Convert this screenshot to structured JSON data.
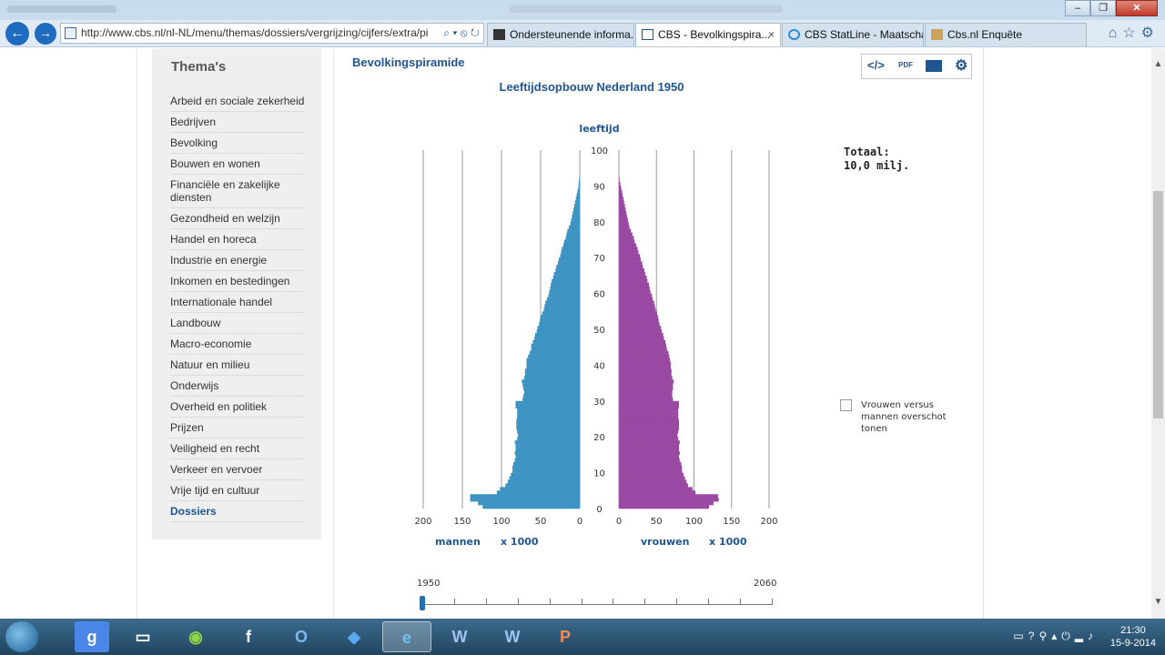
{
  "browser": {
    "address": "http://www.cbs.nl/nl-NL/menu/themas/dossiers/vergrijzing/cijfers/extra/pi",
    "tabs": [
      {
        "label": "Ondersteunende informa..."
      },
      {
        "label": "CBS - Bevolkingspira..."
      },
      {
        "label": "CBS StatLine - Maatscha..."
      },
      {
        "label": "Cbs.nl Enquête"
      }
    ],
    "tab_close": "×"
  },
  "sidebar": {
    "title": "Thema's",
    "items": [
      "Arbeid en sociale zekerheid",
      "Bedrijven",
      "Bevolking",
      "Bouwen en wonen",
      "Financiële en zakelijke diensten",
      "Gezondheid en welzijn",
      "Handel en horeca",
      "Industrie en energie",
      "Inkomen en bestedingen",
      "Internationale handel",
      "Landbouw",
      "Macro-economie",
      "Natuur en milieu",
      "Onderwijs",
      "Overheid en politiek",
      "Prijzen",
      "Veiligheid en recht",
      "Verkeer en vervoer",
      "Vrije tijd en cultuur",
      "Dossiers"
    ]
  },
  "toolbar": {
    "embed_label": "</>",
    "pdf_label": "PDF",
    "image_icon": "image-icon",
    "settings_icon": "gear-icon"
  },
  "chart_data": {
    "type": "bar",
    "title": "Bevolkingspiramide",
    "subtitle": "Leeftijdsopbouw Nederland 1950",
    "ylabel": "leeftijd",
    "x_unit_left": "mannen",
    "x_unit_right": "vrouwen",
    "x_scale_label": "x 1000",
    "xlim": [
      0,
      200
    ],
    "ylim": [
      0,
      100
    ],
    "x_ticks": [
      200,
      150,
      100,
      50,
      0
    ],
    "y_ticks": [
      0,
      10,
      20,
      30,
      40,
      50,
      60,
      70,
      80,
      90,
      100
    ],
    "ages": [
      0,
      1,
      2,
      3,
      4,
      5,
      6,
      7,
      8,
      9,
      10,
      11,
      12,
      13,
      14,
      15,
      16,
      17,
      18,
      19,
      20,
      21,
      22,
      23,
      24,
      25,
      26,
      27,
      28,
      29,
      30,
      31,
      32,
      33,
      34,
      35,
      36,
      37,
      38,
      39,
      40,
      41,
      42,
      43,
      44,
      45,
      46,
      47,
      48,
      49,
      50,
      51,
      52,
      53,
      54,
      55,
      56,
      57,
      58,
      59,
      60,
      61,
      62,
      63,
      64,
      65,
      66,
      67,
      68,
      69,
      70,
      71,
      72,
      73,
      74,
      75,
      76,
      77,
      78,
      79,
      80,
      81,
      82,
      83,
      84,
      85,
      86,
      87,
      88,
      89,
      90,
      91,
      92
    ],
    "series": [
      {
        "name": "mannen",
        "color": "#3d94c2",
        "values": [
          124,
          130,
          140,
          140,
          106,
          102,
          95,
          92,
          90,
          88,
          86,
          86,
          85,
          83,
          82,
          83,
          82,
          82,
          83,
          80,
          79,
          80,
          81,
          81,
          81,
          80,
          80,
          80,
          82,
          82,
          73,
          72,
          71,
          72,
          73,
          74,
          71,
          70,
          70,
          68,
          68,
          68,
          66,
          64,
          62,
          62,
          60,
          58,
          57,
          55,
          54,
          52,
          51,
          50,
          48,
          46,
          45,
          44,
          42,
          40,
          39,
          38,
          37,
          36,
          34,
          33,
          31,
          30,
          28,
          27,
          25,
          24,
          23,
          21,
          20,
          18,
          17,
          16,
          14,
          12,
          11,
          10,
          9,
          8,
          7,
          6,
          5,
          4,
          3,
          2,
          1.5,
          1,
          0.5
        ]
      },
      {
        "name": "vrouwen",
        "color": "#9a49a3",
        "values": [
          120,
          126,
          133,
          132,
          102,
          98,
          92,
          90,
          88,
          86,
          84,
          84,
          83,
          81,
          80,
          81,
          80,
          80,
          81,
          79,
          78,
          79,
          80,
          80,
          80,
          79,
          79,
          79,
          80,
          80,
          72,
          71,
          71,
          72,
          72,
          73,
          71,
          70,
          70,
          69,
          69,
          68,
          67,
          66,
          64,
          63,
          62,
          60,
          59,
          57,
          56,
          54,
          53,
          52,
          51,
          49,
          48,
          47,
          45,
          44,
          42,
          41,
          40,
          38,
          37,
          35,
          34,
          32,
          31,
          29,
          28,
          26,
          25,
          23,
          21,
          20,
          18,
          16,
          14,
          13,
          12,
          11,
          10,
          9,
          8,
          7,
          6,
          5,
          4,
          3,
          2,
          1,
          0.5
        ]
      }
    ],
    "totaal_label": "Totaal:",
    "totaal_value": "10,0 milj."
  },
  "options": {
    "overschot_label": "Vrouwen versus mannen overschot tonen",
    "overschot_checked": false
  },
  "slider": {
    "min_year": "1950",
    "max_year": "2060",
    "value": 1950
  },
  "taskbar": {
    "time": "21:30",
    "date": "15-9-2014",
    "apps": [
      "explorer-icon",
      "google-icon",
      "folder-icon",
      "spotify-icon",
      "facebook-icon",
      "outlook-icon",
      "dropbox-icon",
      "internet-explorer-icon",
      "word-icon",
      "word-doc-icon",
      "powerpoint-icon"
    ]
  }
}
